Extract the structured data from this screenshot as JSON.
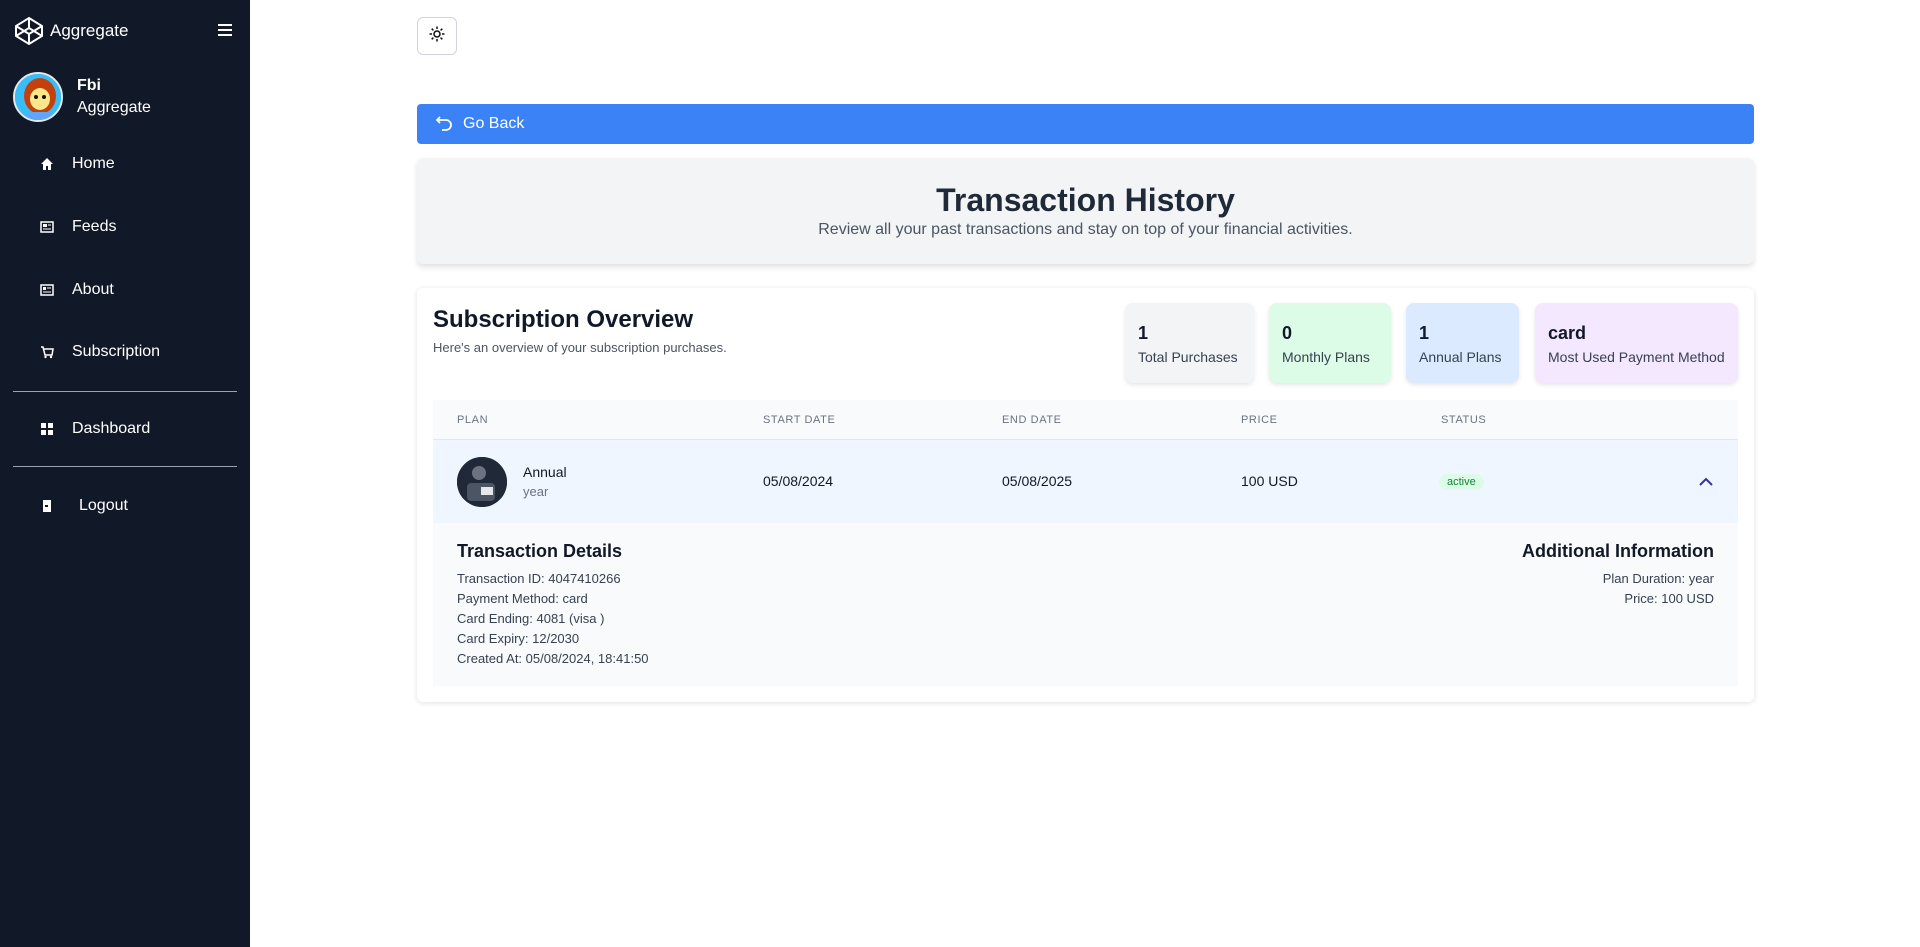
{
  "app": {
    "brand": "Aggregate",
    "brand_icon": "codepen-icon"
  },
  "user": {
    "name": "Fbi",
    "org": "Aggregate"
  },
  "nav": [
    {
      "label": "Home",
      "icon": "home-icon"
    },
    {
      "label": "Feeds",
      "icon": "feeds-icon"
    },
    {
      "label": "About",
      "icon": "about-icon"
    },
    {
      "label": "Subscription",
      "icon": "cart-icon"
    },
    {
      "label": "Dashboard",
      "icon": "dashboard-icon"
    },
    {
      "label": "Logout",
      "icon": "logout-icon"
    }
  ],
  "go_back": {
    "label": "Go Back"
  },
  "hero": {
    "title": "Transaction History",
    "subtitle": "Review all your past transactions and stay on top of your financial activities."
  },
  "overview": {
    "title": "Subscription Overview",
    "subtitle": "Here's an overview of your subscription purchases.",
    "stats": [
      {
        "value": "1",
        "label": "Total Purchases",
        "color": "#f3f4f6"
      },
      {
        "value": "0",
        "label": "Monthly Plans",
        "color": "#dcfce7"
      },
      {
        "value": "1",
        "label": "Annual Plans",
        "color": "#dbeafe"
      },
      {
        "value": "card",
        "label": "Most Used Payment Method",
        "color": "#f3e8ff"
      }
    ]
  },
  "table": {
    "headers": [
      "PLAN",
      "START DATE",
      "END DATE",
      "PRICE",
      "STATUS"
    ],
    "rows": [
      {
        "plan": "Annual",
        "interval": "year",
        "start_date": "05/08/2024",
        "end_date": "05/08/2025",
        "price": "100 USD",
        "status": "active"
      }
    ]
  },
  "details": {
    "title": "Transaction Details",
    "lines": [
      "Transaction ID: 4047410266",
      "Payment Method: card",
      "Card Ending: 4081 (visa )",
      "Card Expiry: 12/2030",
      "Created At: 05/08/2024, 18:41:50"
    ],
    "additional_title": "Additional Information",
    "additional_lines": [
      "Plan Duration: year",
      "Price: 100 USD"
    ]
  },
  "colors": {
    "sidebar": "#111827",
    "accent": "#3b82f6",
    "active_badge": "#15803d"
  }
}
